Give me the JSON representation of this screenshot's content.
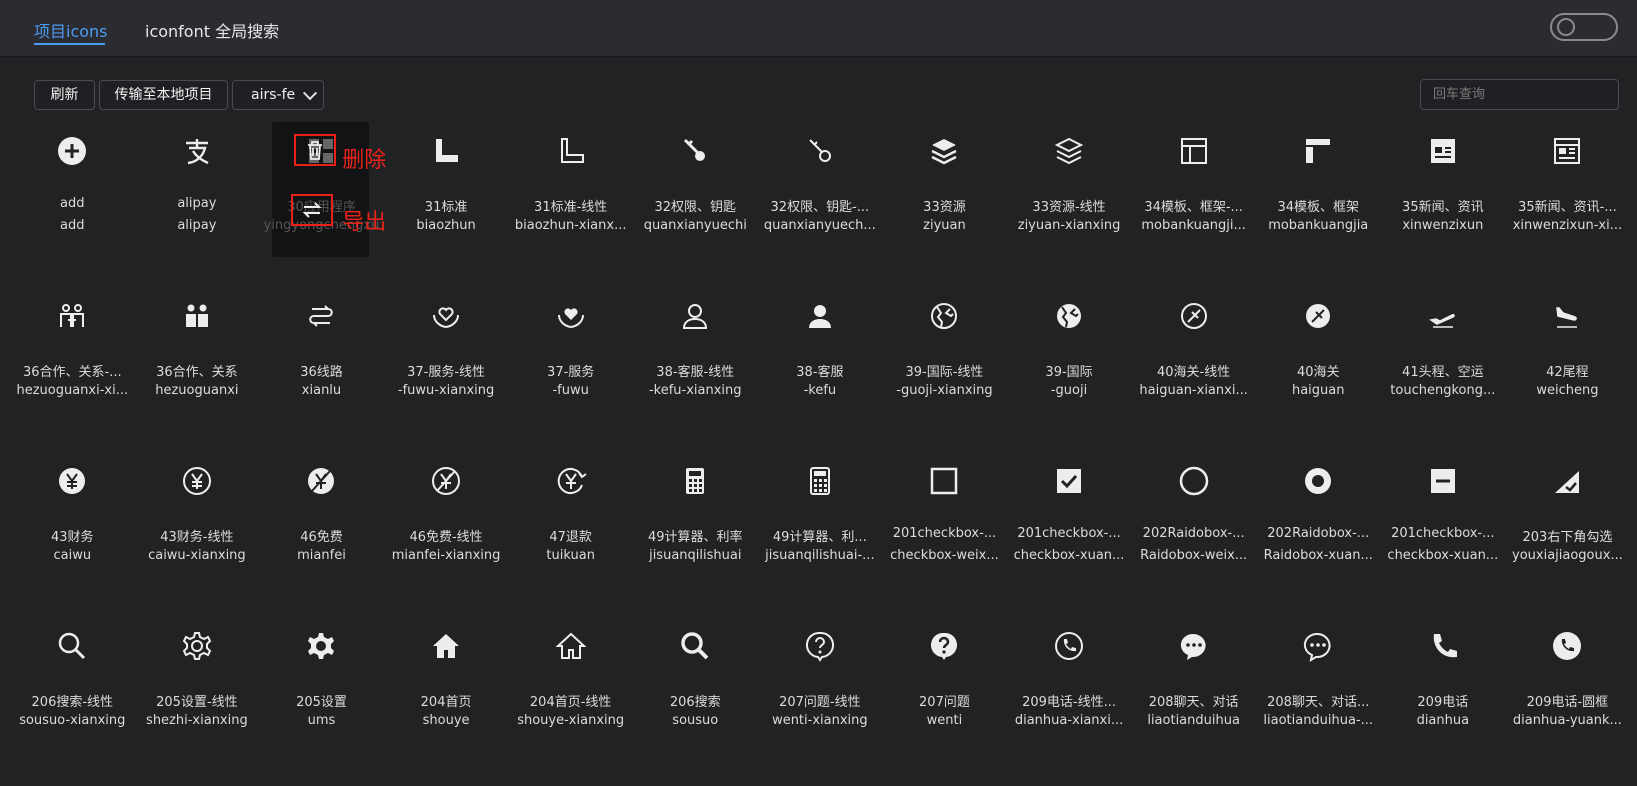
{
  "tabs": [
    {
      "label": "项目icons",
      "active": true
    },
    {
      "label": "iconfont 全局搜索",
      "active": false
    }
  ],
  "toolbar": {
    "refresh_label": "刷新",
    "transfer_label": "传输至本地项目",
    "project_select_value": "airs-fe"
  },
  "search": {
    "placeholder": "回车查询",
    "value": ""
  },
  "hover_actions": {
    "delete_label": "删除",
    "export_label": "导出"
  },
  "colors": {
    "accent": "#4d9cf3",
    "annotation": "#e8221b",
    "background": "#212224"
  },
  "icons": [
    {
      "name": "add",
      "code": "add",
      "icon": "plus-circle-icon"
    },
    {
      "name": "alipay",
      "code": "alipay",
      "icon": "alipay-icon"
    },
    {
      "name": "30应用程序",
      "code": "yingyongchengxu",
      "icon": "grid-apps-icon",
      "hovered": true
    },
    {
      "name": "31标准",
      "code": "biaozhun",
      "icon": "ruler-filled-icon"
    },
    {
      "name": "31标准-线性",
      "code": "biaozhun-xianx...",
      "icon": "ruler-outline-icon"
    },
    {
      "name": "32权限、钥匙",
      "code": "quanxianyuechi",
      "icon": "key-filled-icon"
    },
    {
      "name": "32权限、钥匙-...",
      "code": "quanxianyuech...",
      "icon": "key-outline-icon"
    },
    {
      "name": "33资源",
      "code": "ziyuan",
      "icon": "layers-filled-icon"
    },
    {
      "name": "33资源-线性",
      "code": "ziyuan-xianxing",
      "icon": "layers-outline-icon"
    },
    {
      "name": "34模板、框架-...",
      "code": "mobankuangji...",
      "icon": "template-outline-icon"
    },
    {
      "name": "34模板、框架",
      "code": "mobankuangjia",
      "icon": "template-filled-icon"
    },
    {
      "name": "35新闻、资讯",
      "code": "xinwenzixun",
      "icon": "news-filled-icon"
    },
    {
      "name": "35新闻、资讯-...",
      "code": "xinwenzixun-xi...",
      "icon": "news-outline-icon"
    },
    {
      "name": "36合作、关系-...",
      "code": "hezuoguanxi-xi...",
      "icon": "partners-outline-icon"
    },
    {
      "name": "36合作、关系",
      "code": "hezuoguanxi",
      "icon": "partners-filled-icon"
    },
    {
      "name": "36线路",
      "code": "xianlu",
      "icon": "route-icon"
    },
    {
      "name": "37-服务-线性",
      "code": "-fuwu-xianxing",
      "icon": "service-outline-icon"
    },
    {
      "name": "37-服务",
      "code": "-fuwu",
      "icon": "service-filled-icon"
    },
    {
      "name": "38-客服-线性",
      "code": "-kefu-xianxing",
      "icon": "support-outline-icon"
    },
    {
      "name": "38-客服",
      "code": "-kefu",
      "icon": "support-filled-icon"
    },
    {
      "name": "39-国际-线性",
      "code": "-guoji-xianxing",
      "icon": "globe-outline-icon"
    },
    {
      "name": "39-国际",
      "code": "-guoji",
      "icon": "globe-filled-icon"
    },
    {
      "name": "40海关-线性",
      "code": "haiguan-xianxi...",
      "icon": "customs-outline-icon"
    },
    {
      "name": "40海关",
      "code": "haiguan",
      "icon": "customs-filled-icon"
    },
    {
      "name": "41头程、空运",
      "code": "touchengkong...",
      "icon": "plane-takeoff-icon"
    },
    {
      "name": "42尾程",
      "code": "weicheng",
      "icon": "plane-landing-icon"
    },
    {
      "name": "43财务",
      "code": "caiwu",
      "icon": "yen-filled-icon"
    },
    {
      "name": "43财务-线性",
      "code": "caiwu-xianxing",
      "icon": "yen-outline-icon"
    },
    {
      "name": "46免费",
      "code": "mianfei",
      "icon": "free-filled-icon"
    },
    {
      "name": "46免费-线性",
      "code": "mianfei-xianxing",
      "icon": "free-outline-icon"
    },
    {
      "name": "47退款",
      "code": "tuikuan",
      "icon": "refund-icon"
    },
    {
      "name": "49计算器、利率",
      "code": "jisuanqilishuai",
      "icon": "calculator-filled-icon"
    },
    {
      "name": "49计算器、利...",
      "code": "jisuanqilishuai-...",
      "icon": "calculator-outline-icon"
    },
    {
      "name": "201checkbox-...",
      "code": "checkbox-weix...",
      "icon": "checkbox-empty-icon"
    },
    {
      "name": "201checkbox-...",
      "code": "checkbox-xuan...",
      "icon": "checkbox-checked-icon"
    },
    {
      "name": "202Raidobox-...",
      "code": "Raidobox-weix...",
      "icon": "radio-empty-icon"
    },
    {
      "name": "202Raidobox-...",
      "code": "Raidobox-xuan...",
      "icon": "radio-checked-icon"
    },
    {
      "name": "201checkbox-...",
      "code": "checkbox-xuan...",
      "icon": "checkbox-indeterminate-icon"
    },
    {
      "name": "203右下角勾选",
      "code": "youxiajiaogoux...",
      "icon": "corner-check-icon"
    },
    {
      "name": "206搜索-线性",
      "code": "sousuo-xianxing",
      "icon": "search-outline-icon"
    },
    {
      "name": "205设置-线性",
      "code": "shezhi-xianxing",
      "icon": "gear-outline-icon"
    },
    {
      "name": "205设置",
      "code": "ums",
      "icon": "gear-filled-icon"
    },
    {
      "name": "204首页",
      "code": "shouye",
      "icon": "home-filled-icon"
    },
    {
      "name": "204首页-线性",
      "code": "shouye-xianxing",
      "icon": "home-outline-icon"
    },
    {
      "name": "206搜索",
      "code": "sousuo",
      "icon": "search-filled-icon"
    },
    {
      "name": "207问题-线性",
      "code": "wenti-xianxing",
      "icon": "question-outline-icon"
    },
    {
      "name": "207问题",
      "code": "wenti",
      "icon": "question-filled-icon"
    },
    {
      "name": "209电话-线性...",
      "code": "dianhua-xianxi...",
      "icon": "phone-circle-outline-icon"
    },
    {
      "name": "208聊天、对话",
      "code": "liaotianduihua",
      "icon": "chat-filled-icon"
    },
    {
      "name": "208聊天、对话...",
      "code": "liaotianduihua-...",
      "icon": "chat-outline-icon"
    },
    {
      "name": "209电话",
      "code": "dianhua",
      "icon": "phone-icon"
    },
    {
      "name": "209电话-圆框",
      "code": "dianhua-yuank...",
      "icon": "phone-circle-filled-icon"
    }
  ]
}
